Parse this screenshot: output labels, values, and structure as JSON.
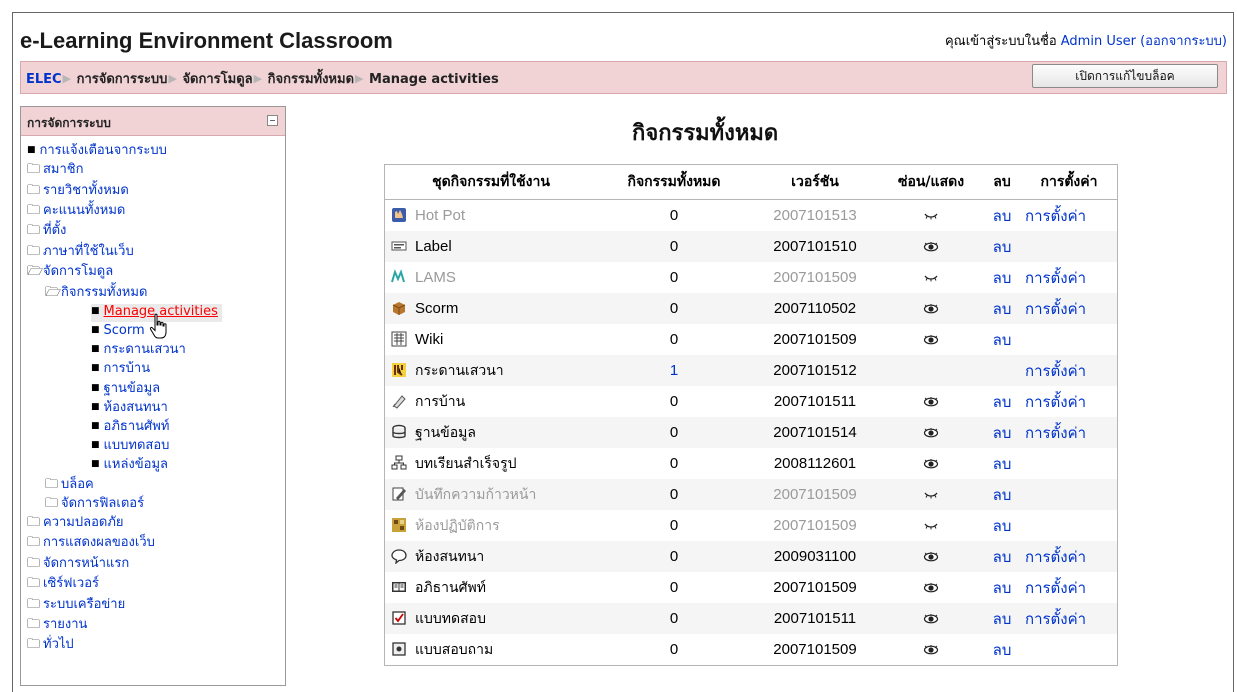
{
  "site": {
    "title": "e-Learning Environment Classroom",
    "login_prefix": "คุณเข้าสู่ระบบในชื่อ ",
    "user_name": "Admin User",
    "logout_text": "(ออกจากระบบ)"
  },
  "navbar": {
    "crumbs": [
      "ELEC",
      "การจัดการระบบ",
      "จัดการโมดูล",
      "กิจกรรมทั้งหมด",
      "Manage activities"
    ],
    "edit_button": "เปิดการแก้ไขบล็อค"
  },
  "sidebar": {
    "title": "การจัดการระบบ",
    "items": [
      {
        "label": "การแจ้งเตือนจากระบบ",
        "type": "bullet",
        "level": 0
      },
      {
        "label": "สมาชิก",
        "type": "folder",
        "level": 0
      },
      {
        "label": "รายวิชาทั้งหมด",
        "type": "folder",
        "level": 0
      },
      {
        "label": "คะแนนทั้งหมด",
        "type": "folder",
        "level": 0
      },
      {
        "label": "ที่ตั้ง",
        "type": "folder",
        "level": 0
      },
      {
        "label": "ภาษาที่ใช้ในเว็บ",
        "type": "folder",
        "level": 0
      },
      {
        "label": "จัดการโมดูล",
        "type": "open-folder",
        "level": 0
      },
      {
        "label": "กิจกรรมทั้งหมด",
        "type": "open-folder",
        "level": 1
      },
      {
        "label": "Manage activities",
        "type": "bullet",
        "level": 2,
        "current": true
      },
      {
        "label": "Scorm",
        "type": "bullet",
        "level": 2
      },
      {
        "label": "กระดานเสวนา",
        "type": "bullet",
        "level": 2
      },
      {
        "label": "การบ้าน",
        "type": "bullet",
        "level": 2
      },
      {
        "label": "ฐานข้อมูล",
        "type": "bullet",
        "level": 2
      },
      {
        "label": "ห้องสนทนา",
        "type": "bullet",
        "level": 2
      },
      {
        "label": "อภิธานศัพท์",
        "type": "bullet",
        "level": 2
      },
      {
        "label": "แบบทดสอบ",
        "type": "bullet",
        "level": 2
      },
      {
        "label": "แหล่งข้อมูล",
        "type": "bullet",
        "level": 2
      },
      {
        "label": "บล็อค",
        "type": "folder",
        "level": 1
      },
      {
        "label": "จัดการฟิลเตอร์",
        "type": "folder",
        "level": 1
      },
      {
        "label": "ความปลอดภัย",
        "type": "folder",
        "level": 0
      },
      {
        "label": "การแสดงผลของเว็บ",
        "type": "folder",
        "level": 0
      },
      {
        "label": "จัดการหน้าแรก",
        "type": "folder",
        "level": 0
      },
      {
        "label": "เซิร์ฟเวอร์",
        "type": "folder",
        "level": 0
      },
      {
        "label": "ระบบเครือข่าย",
        "type": "folder",
        "level": 0
      },
      {
        "label": "รายงาน",
        "type": "folder",
        "level": 0
      },
      {
        "label": "ทั่วไป",
        "type": "folder",
        "level": 0
      }
    ]
  },
  "main": {
    "heading": "กิจกรรมทั้งหมด",
    "columns": [
      "ชุดกิจกรรมที่ใช้งาน",
      "กิจกรรมทั้งหมด",
      "เวอร์ชัน",
      "ซ่อน/แสดง",
      "ลบ",
      "การตั้งค่า"
    ],
    "rows": [
      {
        "icon": "hotpot-icon",
        "name": "Hot Pot",
        "count": "0",
        "version": "2007101513",
        "visibility": "hidden",
        "delete": "ลบ",
        "settings": "การตั้งค่า",
        "hidden": true
      },
      {
        "icon": "label-icon",
        "name": "Label",
        "count": "0",
        "version": "2007101510",
        "visibility": "shown",
        "delete": "ลบ",
        "settings": "",
        "hidden": false
      },
      {
        "icon": "lams-icon",
        "name": "LAMS",
        "count": "0",
        "version": "2007101509",
        "visibility": "hidden",
        "delete": "ลบ",
        "settings": "การตั้งค่า",
        "hidden": true
      },
      {
        "icon": "scorm-icon",
        "name": "Scorm",
        "count": "0",
        "version": "2007110502",
        "visibility": "shown",
        "delete": "ลบ",
        "settings": "การตั้งค่า",
        "hidden": false
      },
      {
        "icon": "wiki-icon",
        "name": "Wiki",
        "count": "0",
        "version": "2007101509",
        "visibility": "shown",
        "delete": "ลบ",
        "settings": "",
        "hidden": false
      },
      {
        "icon": "forum-icon",
        "name": "กระดานเสวนา",
        "count": "1",
        "count_link": true,
        "version": "2007101512",
        "visibility": "none",
        "delete": "",
        "settings": "การตั้งค่า",
        "hidden": false
      },
      {
        "icon": "assignment-icon",
        "name": "การบ้าน",
        "count": "0",
        "version": "2007101511",
        "visibility": "shown",
        "delete": "ลบ",
        "settings": "การตั้งค่า",
        "hidden": false
      },
      {
        "icon": "database-icon",
        "name": "ฐานข้อมูล",
        "count": "0",
        "version": "2007101514",
        "visibility": "shown",
        "delete": "ลบ",
        "settings": "การตั้งค่า",
        "hidden": false
      },
      {
        "icon": "lesson-icon",
        "name": "บทเรียนสำเร็จรูป",
        "count": "0",
        "version": "2008112601",
        "visibility": "shown",
        "delete": "ลบ",
        "settings": "",
        "hidden": false
      },
      {
        "icon": "journal-icon",
        "name": "บันทึกความก้าวหน้า",
        "count": "0",
        "version": "2007101509",
        "visibility": "hidden",
        "delete": "ลบ",
        "settings": "",
        "hidden": true
      },
      {
        "icon": "workshop-icon",
        "name": "ห้องปฏิบัติการ",
        "count": "0",
        "version": "2007101509",
        "visibility": "hidden",
        "delete": "ลบ",
        "settings": "",
        "hidden": true
      },
      {
        "icon": "chat-icon",
        "name": "ห้องสนทนา",
        "count": "0",
        "version": "2009031100",
        "visibility": "shown",
        "delete": "ลบ",
        "settings": "การตั้งค่า",
        "hidden": false
      },
      {
        "icon": "glossary-icon",
        "name": "อภิธานศัพท์",
        "count": "0",
        "version": "2007101509",
        "visibility": "shown",
        "delete": "ลบ",
        "settings": "การตั้งค่า",
        "hidden": false
      },
      {
        "icon": "quiz-icon",
        "name": "แบบทดสอบ",
        "count": "0",
        "version": "2007101511",
        "visibility": "shown",
        "delete": "ลบ",
        "settings": "การตั้งค่า",
        "hidden": false
      },
      {
        "icon": "survey-icon",
        "name": "แบบสอบถาม",
        "count": "0",
        "version": "2007101509",
        "visibility": "shown",
        "delete": "ลบ",
        "settings": "",
        "hidden": false
      }
    ]
  }
}
